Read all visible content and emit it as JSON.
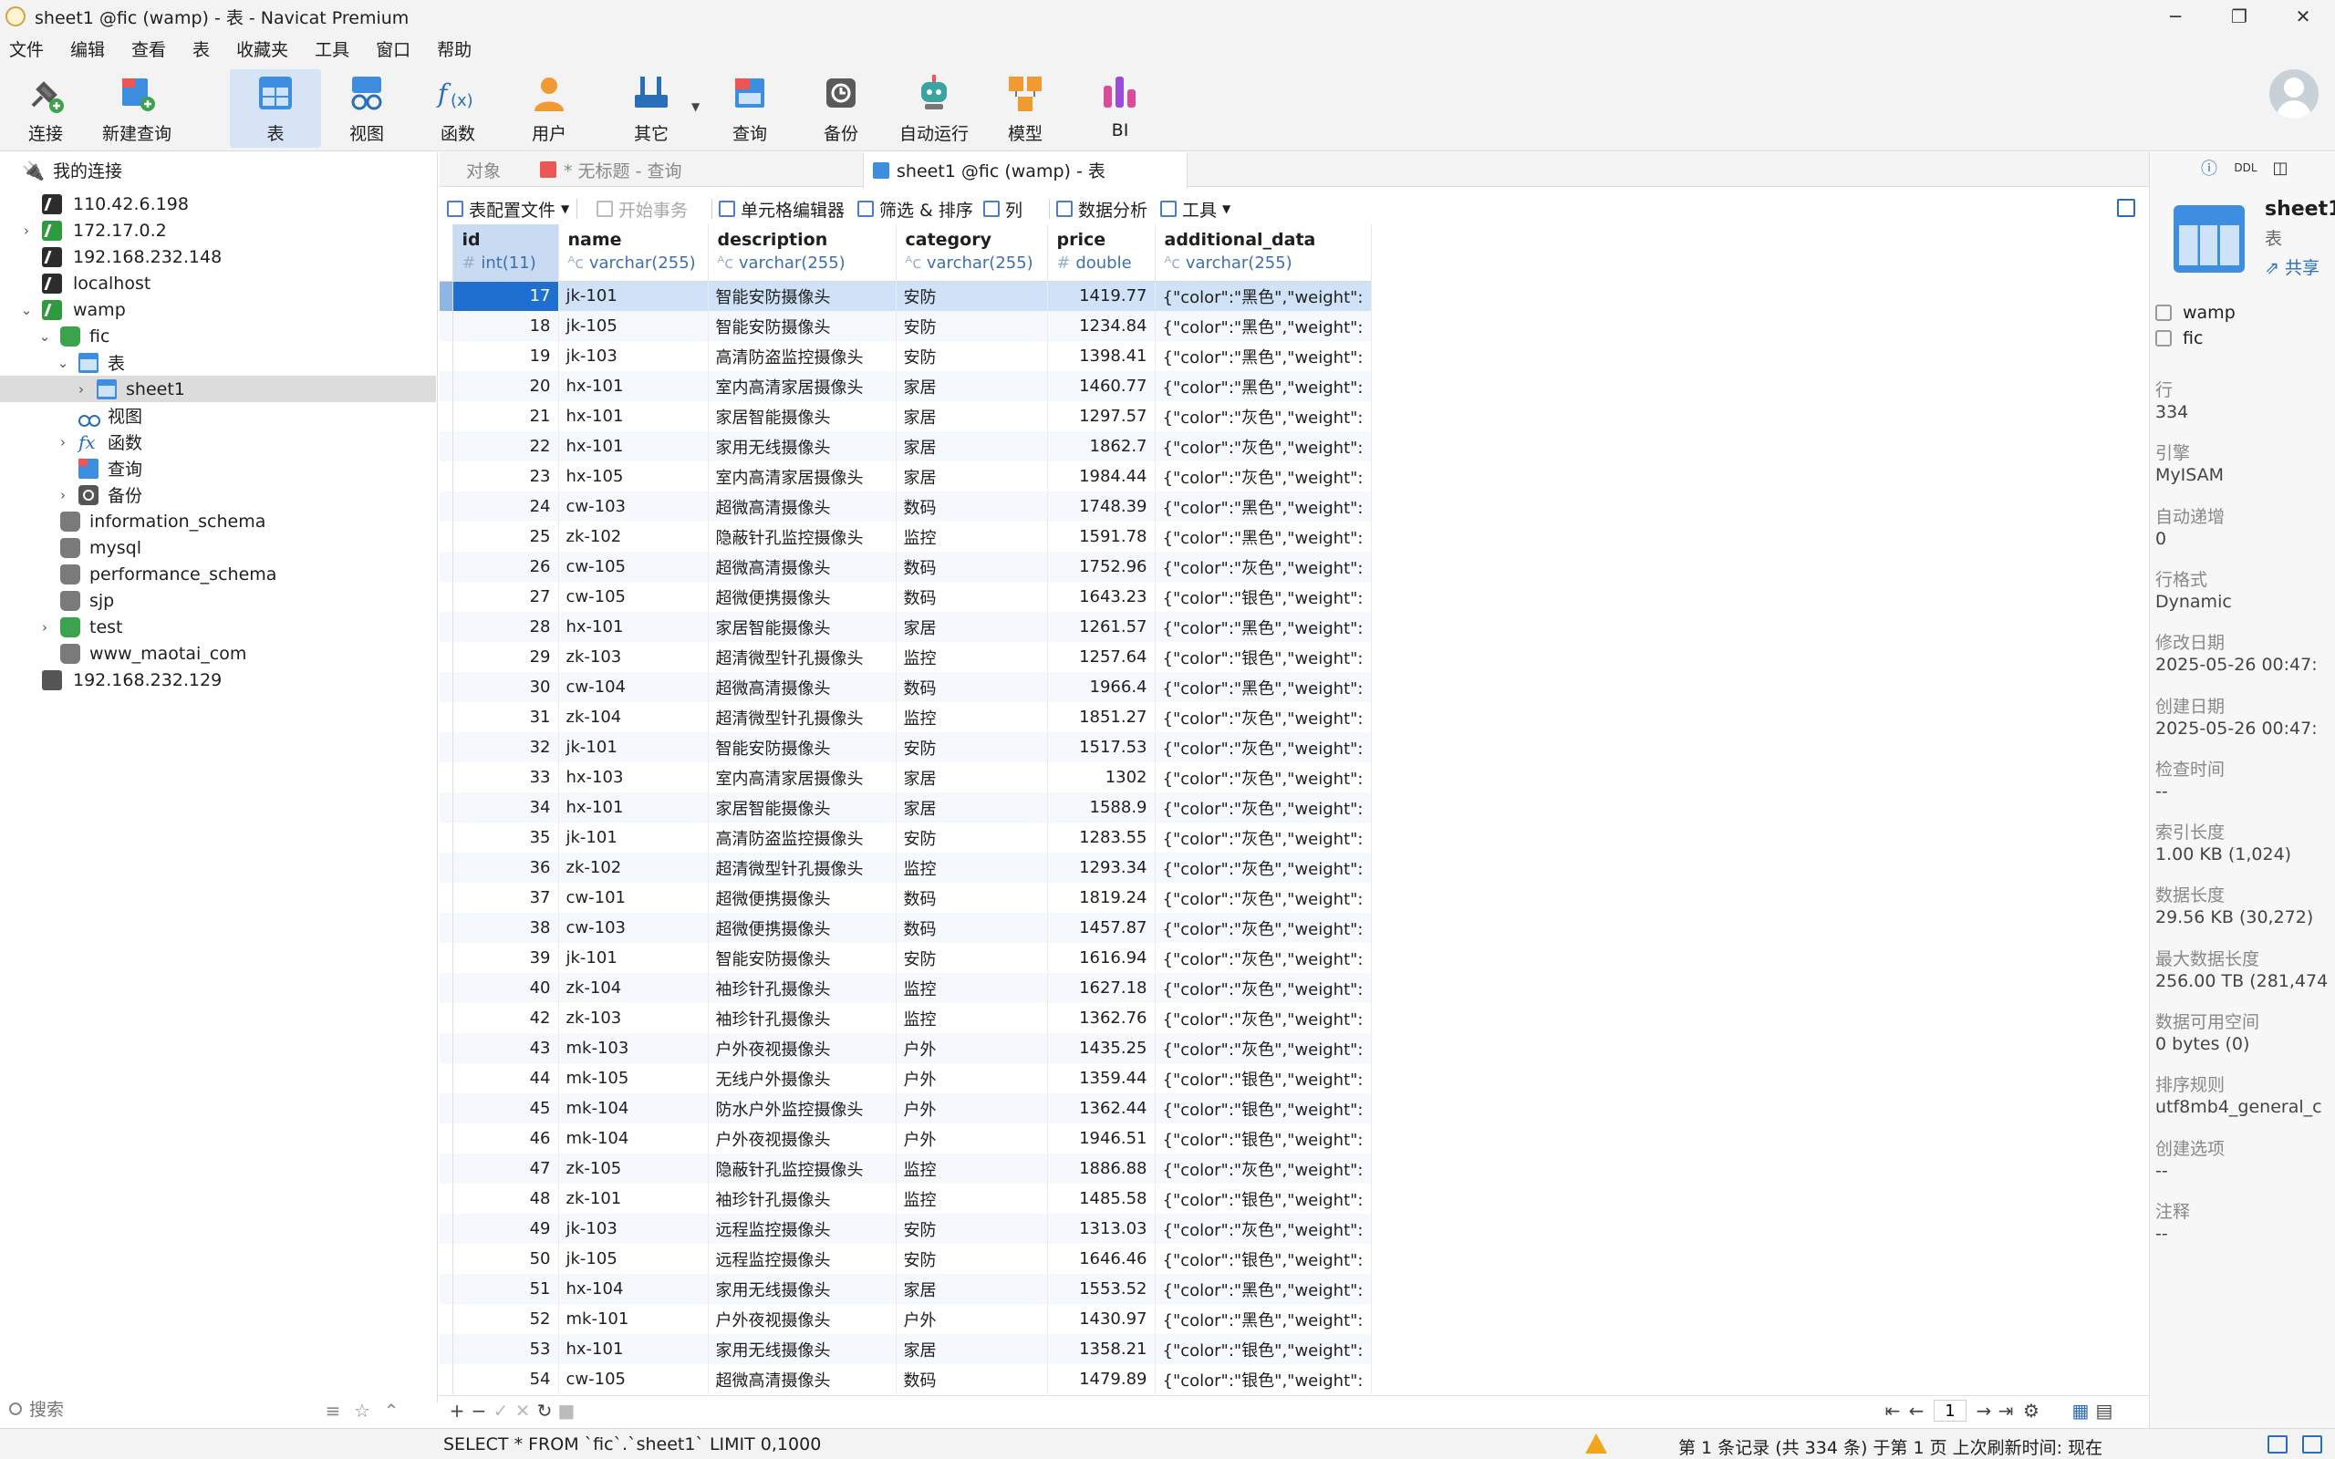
{
  "window": {
    "title": "sheet1 @fic (wamp) - 表 - Navicat Premium",
    "controls": [
      "─",
      "❐",
      "✕"
    ]
  },
  "menu": [
    "文件",
    "编辑",
    "查看",
    "表",
    "收藏夹",
    "工具",
    "窗口",
    "帮助"
  ],
  "toolbar": {
    "items": [
      {
        "label": "连接",
        "icon": "connect-icon"
      },
      {
        "label": "新建查询",
        "icon": "new-query-icon"
      },
      {
        "label": "表",
        "icon": "table-icon"
      },
      {
        "label": "视图",
        "icon": "view-icon"
      },
      {
        "label": "函数",
        "icon": "function-icon"
      },
      {
        "label": "用户",
        "icon": "user-icon"
      },
      {
        "label": "其它",
        "icon": "tools-icon"
      },
      {
        "label": "查询",
        "icon": "query-icon"
      },
      {
        "label": "备份",
        "icon": "backup-icon"
      },
      {
        "label": "自动运行",
        "icon": "robot-icon"
      },
      {
        "label": "模型",
        "icon": "model-icon"
      },
      {
        "label": "BI",
        "icon": "bi-icon"
      }
    ],
    "active": "表",
    "colors": {
      "accent": "#2a6db8",
      "connect": "#3aa34b",
      "bi": "#d94b9b",
      "model": "#f09a34"
    }
  },
  "nav": {
    "root": "我的连接",
    "tree": [
      {
        "label": "110.42.6.198",
        "icon": "mysql-connection-icon"
      },
      {
        "label": "172.17.0.2",
        "icon": "mysql-connection-icon"
      },
      {
        "label": "192.168.232.148",
        "icon": "mysql-connection-icon"
      },
      {
        "label": "localhost",
        "icon": "mysql-connection-icon"
      },
      {
        "label": "wamp",
        "icon": "mysql-connection-open-icon"
      },
      {
        "label": "fic",
        "icon": "database-open-icon"
      },
      {
        "label": "表",
        "icon": "tables-folder-icon"
      },
      {
        "label": "sheet1",
        "icon": "table-icon"
      },
      {
        "label": "视图",
        "icon": "views-folder-icon"
      },
      {
        "label": "函数",
        "icon": "functions-folder-icon"
      },
      {
        "label": "查询",
        "icon": "queries-folder-icon"
      },
      {
        "label": "备份",
        "icon": "backups-folder-icon"
      },
      {
        "label": "information_schema",
        "icon": "database-icon"
      },
      {
        "label": "mysql",
        "icon": "database-icon"
      },
      {
        "label": "performance_schema",
        "icon": "database-icon"
      },
      {
        "label": "sjp",
        "icon": "database-icon"
      },
      {
        "label": "test",
        "icon": "database-open-icon"
      },
      {
        "label": "www_maotai_com",
        "icon": "database-icon"
      },
      {
        "label": "192.168.232.129",
        "icon": "mariadb-connection-icon"
      }
    ],
    "search_placeholder": "搜索"
  },
  "tabs": [
    {
      "label": "对象"
    },
    {
      "label": "* 无标题 - 查询"
    },
    {
      "label": "sheet1 @fic (wamp) - 表"
    }
  ],
  "gridbar": {
    "config_file": "表配置文件",
    "begin_transaction": "开始事务",
    "cell_editor": "单元格编辑器",
    "filter_sort": "筛选 & 排序",
    "columns": "列",
    "data_analysis": "数据分析",
    "tools": "工具"
  },
  "columns": [
    {
      "name": "id",
      "type": "int(11)"
    },
    {
      "name": "name",
      "type": "varchar(255)"
    },
    {
      "name": "description",
      "type": "varchar(255)"
    },
    {
      "name": "category",
      "type": "varchar(255)"
    },
    {
      "name": "price",
      "type": "double"
    },
    {
      "name": "additional_data",
      "type": "varchar(255)"
    }
  ],
  "rows": [
    [
      "17",
      "jk-101",
      "智能安防摄像头",
      "安防",
      "1419.77",
      "{\"color\":\"黑色\",\"weight\":"
    ],
    [
      "18",
      "jk-105",
      "智能安防摄像头",
      "安防",
      "1234.84",
      "{\"color\":\"黑色\",\"weight\":"
    ],
    [
      "19",
      "jk-103",
      "高清防盗监控摄像头",
      "安防",
      "1398.41",
      "{\"color\":\"黑色\",\"weight\":"
    ],
    [
      "20",
      "hx-101",
      "室内高清家居摄像头",
      "家居",
      "1460.77",
      "{\"color\":\"黑色\",\"weight\":"
    ],
    [
      "21",
      "hx-101",
      "家居智能摄像头",
      "家居",
      "1297.57",
      "{\"color\":\"灰色\",\"weight\":"
    ],
    [
      "22",
      "hx-101",
      "家用无线摄像头",
      "家居",
      "1862.7",
      "{\"color\":\"灰色\",\"weight\":"
    ],
    [
      "23",
      "hx-105",
      "室内高清家居摄像头",
      "家居",
      "1984.44",
      "{\"color\":\"灰色\",\"weight\":"
    ],
    [
      "24",
      "cw-103",
      "超微高清摄像头",
      "数码",
      "1748.39",
      "{\"color\":\"黑色\",\"weight\":"
    ],
    [
      "25",
      "zk-102",
      "隐蔽针孔监控摄像头",
      "监控",
      "1591.78",
      "{\"color\":\"黑色\",\"weight\":"
    ],
    [
      "26",
      "cw-105",
      "超微高清摄像头",
      "数码",
      "1752.96",
      "{\"color\":\"灰色\",\"weight\":"
    ],
    [
      "27",
      "cw-105",
      "超微便携摄像头",
      "数码",
      "1643.23",
      "{\"color\":\"银色\",\"weight\":"
    ],
    [
      "28",
      "hx-101",
      "家居智能摄像头",
      "家居",
      "1261.57",
      "{\"color\":\"黑色\",\"weight\":"
    ],
    [
      "29",
      "zk-103",
      "超清微型针孔摄像头",
      "监控",
      "1257.64",
      "{\"color\":\"银色\",\"weight\":"
    ],
    [
      "30",
      "cw-104",
      "超微高清摄像头",
      "数码",
      "1966.4",
      "{\"color\":\"黑色\",\"weight\":"
    ],
    [
      "31",
      "zk-104",
      "超清微型针孔摄像头",
      "监控",
      "1851.27",
      "{\"color\":\"灰色\",\"weight\":"
    ],
    [
      "32",
      "jk-101",
      "智能安防摄像头",
      "安防",
      "1517.53",
      "{\"color\":\"灰色\",\"weight\":"
    ],
    [
      "33",
      "hx-103",
      "室内高清家居摄像头",
      "家居",
      "1302",
      "{\"color\":\"灰色\",\"weight\":"
    ],
    [
      "34",
      "hx-101",
      "家居智能摄像头",
      "家居",
      "1588.9",
      "{\"color\":\"灰色\",\"weight\":"
    ],
    [
      "35",
      "jk-101",
      "高清防盗监控摄像头",
      "安防",
      "1283.55",
      "{\"color\":\"灰色\",\"weight\":"
    ],
    [
      "36",
      "zk-102",
      "超清微型针孔摄像头",
      "监控",
      "1293.34",
      "{\"color\":\"灰色\",\"weight\":"
    ],
    [
      "37",
      "cw-101",
      "超微便携摄像头",
      "数码",
      "1819.24",
      "{\"color\":\"灰色\",\"weight\":"
    ],
    [
      "38",
      "cw-103",
      "超微便携摄像头",
      "数码",
      "1457.87",
      "{\"color\":\"灰色\",\"weight\":"
    ],
    [
      "39",
      "jk-101",
      "智能安防摄像头",
      "安防",
      "1616.94",
      "{\"color\":\"灰色\",\"weight\":"
    ],
    [
      "40",
      "zk-104",
      "袖珍针孔摄像头",
      "监控",
      "1627.18",
      "{\"color\":\"灰色\",\"weight\":"
    ],
    [
      "42",
      "zk-103",
      "袖珍针孔摄像头",
      "监控",
      "1362.76",
      "{\"color\":\"灰色\",\"weight\":"
    ],
    [
      "43",
      "mk-103",
      "户外夜视摄像头",
      "户外",
      "1435.25",
      "{\"color\":\"灰色\",\"weight\":"
    ],
    [
      "44",
      "mk-105",
      "无线户外摄像头",
      "户外",
      "1359.44",
      "{\"color\":\"银色\",\"weight\":"
    ],
    [
      "45",
      "mk-104",
      "防水户外监控摄像头",
      "户外",
      "1362.44",
      "{\"color\":\"银色\",\"weight\":"
    ],
    [
      "46",
      "mk-104",
      "户外夜视摄像头",
      "户外",
      "1946.51",
      "{\"color\":\"银色\",\"weight\":"
    ],
    [
      "47",
      "zk-105",
      "隐蔽针孔监控摄像头",
      "监控",
      "1886.88",
      "{\"color\":\"灰色\",\"weight\":"
    ],
    [
      "48",
      "zk-101",
      "袖珍针孔摄像头",
      "监控",
      "1485.58",
      "{\"color\":\"银色\",\"weight\":"
    ],
    [
      "49",
      "jk-103",
      "远程监控摄像头",
      "安防",
      "1313.03",
      "{\"color\":\"灰色\",\"weight\":"
    ],
    [
      "50",
      "jk-105",
      "远程监控摄像头",
      "安防",
      "1646.46",
      "{\"color\":\"银色\",\"weight\":"
    ],
    [
      "51",
      "hx-104",
      "家用无线摄像头",
      "家居",
      "1553.52",
      "{\"color\":\"黑色\",\"weight\":"
    ],
    [
      "52",
      "mk-101",
      "户外夜视摄像头",
      "户外",
      "1430.97",
      "{\"color\":\"黑色\",\"weight\":"
    ],
    [
      "53",
      "hx-101",
      "家用无线摄像头",
      "家居",
      "1358.21",
      "{\"color\":\"银色\",\"weight\":"
    ],
    [
      "54",
      "cw-105",
      "超微高清摄像头",
      "数码",
      "1479.89",
      "{\"color\":\"银色\",\"weight\":"
    ]
  ],
  "selected_row_id": "17",
  "pagination": {
    "page": "1"
  },
  "status": {
    "sql": "SELECT * FROM `fic`.`sheet1` LIMIT 0,1000",
    "records": "第 1 条记录 (共 334 条) 于第 1 页   上次刷新时间: 现在"
  },
  "info": {
    "name": "sheet1",
    "type": "表",
    "share": "共享",
    "connection": "wamp",
    "database": "fic",
    "properties": [
      {
        "label": "行",
        "value": "334"
      },
      {
        "label": "引擎",
        "value": "MyISAM"
      },
      {
        "label": "自动递增",
        "value": "0"
      },
      {
        "label": "行格式",
        "value": "Dynamic"
      },
      {
        "label": "修改日期",
        "value": "2025-05-26 00:47:"
      },
      {
        "label": "创建日期",
        "value": "2025-05-26 00:47:"
      },
      {
        "label": "检查时间",
        "value": "--"
      },
      {
        "label": "索引长度",
        "value": "1.00 KB (1,024)"
      },
      {
        "label": "数据长度",
        "value": "29.56 KB (30,272)"
      },
      {
        "label": "最大数据长度",
        "value": "256.00 TB (281,474"
      },
      {
        "label": "数据可用空间",
        "value": "0 bytes (0)"
      },
      {
        "label": "排序规则",
        "value": "utf8mb4_general_c"
      },
      {
        "label": "创建选项",
        "value": "--"
      },
      {
        "label": "注释",
        "value": "--"
      }
    ]
  }
}
